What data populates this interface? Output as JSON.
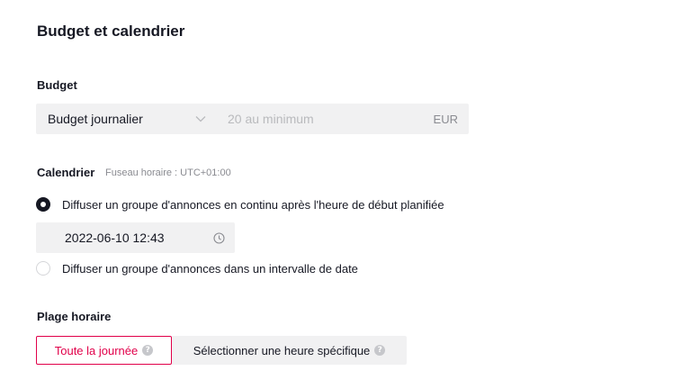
{
  "section": {
    "title": "Budget et calendrier"
  },
  "budget": {
    "label": "Budget",
    "type_select": {
      "value": "Budget journalier"
    },
    "amount_input": {
      "value": "",
      "placeholder": "20 au minimum"
    },
    "currency": "EUR"
  },
  "calendar": {
    "label": "Calendrier",
    "timezone_note": "Fuseau horaire : UTC+01:00",
    "options": [
      {
        "label": "Diffuser un groupe d'annonces en continu après l'heure de début planifiée",
        "selected": true
      },
      {
        "label": "Diffuser un groupe d'annonces dans un intervalle de date",
        "selected": false
      }
    ],
    "start_datetime": "2022-06-10 12:43"
  },
  "time_range": {
    "label": "Plage horaire",
    "options": [
      {
        "label": "Toute la journée",
        "selected": true
      },
      {
        "label": "Sélectionner une heure spécifique",
        "selected": false
      }
    ]
  },
  "colors": {
    "accent": "#e1004a",
    "text": "#161823",
    "field_bg": "#f1f1f2",
    "muted": "#8a8b91"
  },
  "icons": {
    "chevron": "chevron-down-icon",
    "clock": "clock-icon",
    "help": "question-circle-icon"
  }
}
